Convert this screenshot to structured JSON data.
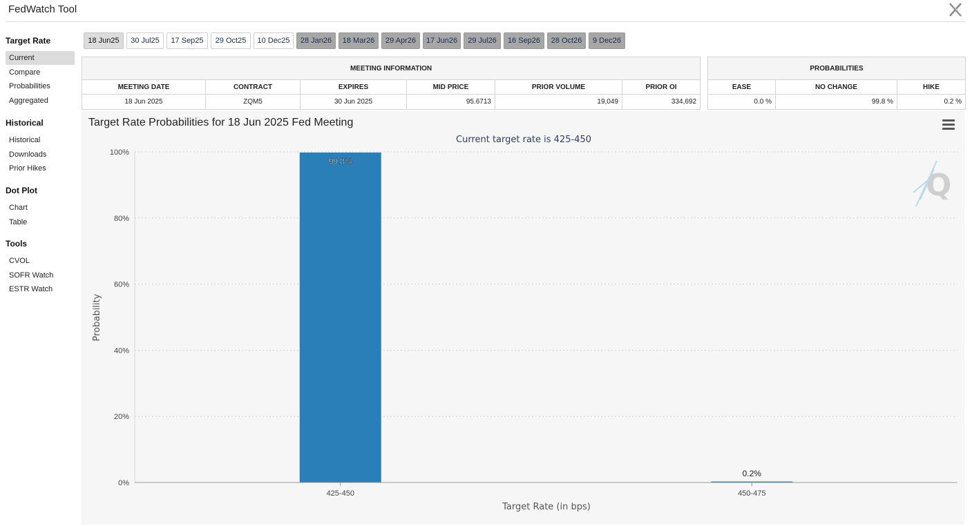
{
  "app": {
    "title": "FedWatch Tool"
  },
  "sidebar": {
    "sections": [
      {
        "heading": "Target Rate",
        "items": [
          "Current",
          "Compare",
          "Probabilities",
          "Aggregated"
        ]
      },
      {
        "heading": "Historical",
        "items": [
          "Historical",
          "Downloads",
          "Prior Hikes"
        ]
      },
      {
        "heading": "Dot Plot",
        "items": [
          "Chart",
          "Table"
        ]
      },
      {
        "heading": "Tools",
        "items": [
          "CVOL",
          "SOFR Watch",
          "ESTR Watch"
        ]
      }
    ],
    "active_item": "Current"
  },
  "tabs": [
    {
      "label": "18 Jun25",
      "state": "active"
    },
    {
      "label": "30 Jul25",
      "state": "normal"
    },
    {
      "label": "17 Sep25",
      "state": "normal"
    },
    {
      "label": "29 Oct25",
      "state": "normal"
    },
    {
      "label": "10 Dec25",
      "state": "normal"
    },
    {
      "label": "28 Jan26",
      "state": "dim"
    },
    {
      "label": "18 Mar26",
      "state": "dim"
    },
    {
      "label": "29 Apr26",
      "state": "dim"
    },
    {
      "label": "17 Jun26",
      "state": "dim"
    },
    {
      "label": "29 Jul26",
      "state": "dim"
    },
    {
      "label": "16 Sep26",
      "state": "dim"
    },
    {
      "label": "28 Oct26",
      "state": "dim"
    },
    {
      "label": "9 Dec26",
      "state": "dim"
    }
  ],
  "meeting_info": {
    "heading": "MEETING INFORMATION",
    "columns": [
      "MEETING DATE",
      "CONTRACT",
      "EXPIRES",
      "MID PRICE",
      "PRIOR VOLUME",
      "PRIOR OI"
    ],
    "row": [
      "18 Jun 2025",
      "ZQM5",
      "30 Jun 2025",
      "95.6713",
      "19,049",
      "334,692"
    ]
  },
  "probabilities": {
    "heading": "PROBABILITIES",
    "columns": [
      "EASE",
      "NO CHANGE",
      "HIKE"
    ],
    "row": [
      "0.0 %",
      "99.8 %",
      "0.2 %"
    ]
  },
  "chart_panel": {
    "title": "Target Rate Probabilities for 18 Jun 2025 Fed Meeting"
  },
  "chart_data": {
    "type": "bar",
    "subtitle": "Current target rate is 425-450",
    "categories": [
      "425-450",
      "450-475"
    ],
    "values": [
      99.8,
      0.2
    ],
    "data_labels": [
      "99.8%",
      "0.2%"
    ],
    "xlabel": "Target Rate (in bps)",
    "ylabel": "Probability",
    "ylim": [
      0,
      100
    ],
    "yticks": [
      "0%",
      "20%",
      "40%",
      "60%",
      "80%",
      "100%"
    ],
    "grid": true,
    "bar_color": "#2a7fb8"
  },
  "colors": {
    "bar": "#2a7fb8",
    "panel": "#f6f6f6",
    "active_tab": "#dcdcdc",
    "dim_tab": "#a7a7a7"
  }
}
